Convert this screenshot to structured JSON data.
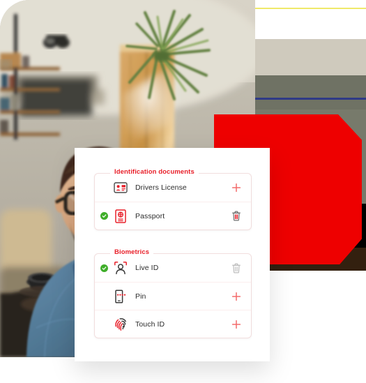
{
  "scene": {
    "photo_alt": "smiling-man-with-glasses-in-living-room",
    "accent_red": "#e8202a",
    "shape_red": "#ee0000",
    "check_green": "#3fae2a",
    "plus_color": "#f36b6b",
    "trash_color": "#6f6f6f"
  },
  "card": {
    "groups": [
      {
        "key": "identification-documents",
        "legend": "Identification documents",
        "rows": [
          {
            "label": "Drivers License",
            "icon": "id-card-icon",
            "verified": false,
            "action": "add",
            "action_icon": "plus-icon"
          },
          {
            "label": "Passport",
            "icon": "passport-icon",
            "verified": true,
            "action": "delete",
            "action_icon": "trash-icon"
          }
        ]
      },
      {
        "key": "biometrics",
        "legend": "Biometrics",
        "rows": [
          {
            "label": "Live ID",
            "icon": "face-scan-icon",
            "verified": true,
            "action": "delete",
            "action_icon": "trash-icon"
          },
          {
            "label": "Pin",
            "icon": "phone-pin-icon",
            "verified": false,
            "action": "add",
            "action_icon": "plus-icon"
          },
          {
            "label": "Touch ID",
            "icon": "fingerprint-icon",
            "verified": false,
            "action": "add",
            "action_icon": "plus-icon"
          }
        ]
      }
    ]
  }
}
